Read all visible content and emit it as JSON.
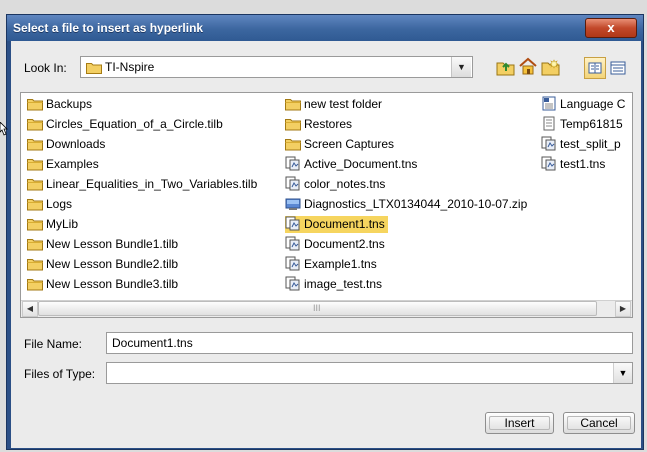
{
  "dialog": {
    "title": "Select a file to insert as hyperlink",
    "close_label": "x"
  },
  "look_in": {
    "label": "Look In:",
    "value": "TI-Nspire"
  },
  "toolbar": {
    "icons": [
      "up-folder-icon",
      "home-icon",
      "new-folder-icon",
      "list-view-icon",
      "details-view-icon"
    ],
    "selected_view": "list"
  },
  "files": {
    "columns": [
      [
        {
          "name": "Backups",
          "type": "folder"
        },
        {
          "name": "Circles_Equation_of_a_Circle.tilb",
          "type": "folder"
        },
        {
          "name": "Downloads",
          "type": "folder"
        },
        {
          "name": "Examples",
          "type": "folder"
        },
        {
          "name": "Linear_Equalities_in_Two_Variables.tilb",
          "type": "folder"
        },
        {
          "name": "Logs",
          "type": "folder"
        },
        {
          "name": "MyLib",
          "type": "folder"
        },
        {
          "name": "New Lesson Bundle1.tilb",
          "type": "folder"
        },
        {
          "name": "New Lesson Bundle2.tilb",
          "type": "folder"
        },
        {
          "name": "New Lesson Bundle3.tilb",
          "type": "folder"
        }
      ],
      [
        {
          "name": "new test folder",
          "type": "folder"
        },
        {
          "name": "Restores",
          "type": "folder"
        },
        {
          "name": "Screen Captures",
          "type": "folder"
        },
        {
          "name": "Active_Document.tns",
          "type": "tns"
        },
        {
          "name": "color_notes.tns",
          "type": "tns"
        },
        {
          "name": "Diagnostics_LTX0134044_2010-10-07.zip",
          "type": "zip"
        },
        {
          "name": "Document1.tns",
          "type": "tns",
          "selected": true
        },
        {
          "name": "Document2.tns",
          "type": "tns"
        },
        {
          "name": "Example1.tns",
          "type": "tns"
        },
        {
          "name": "image_test.tns",
          "type": "tns"
        }
      ],
      [
        {
          "name": "Language C",
          "type": "doc"
        },
        {
          "name": "Temp61815",
          "type": "txt"
        },
        {
          "name": "test_split_p",
          "type": "tns"
        },
        {
          "name": "test1.tns",
          "type": "tns"
        }
      ]
    ]
  },
  "scrollbar": {
    "left_arrow": "◀",
    "right_arrow": "▶",
    "grip": "III"
  },
  "file_name": {
    "label": "File Name:",
    "value": "Document1.tns"
  },
  "files_of_type": {
    "label": "Files of Type:",
    "value": ""
  },
  "buttons": {
    "insert": "Insert",
    "cancel": "Cancel"
  },
  "colors": {
    "title_bar": "#3c669f",
    "selection": "#f6d55f",
    "folder_fill": "#f3cf63",
    "close_button": "#c2482a"
  }
}
